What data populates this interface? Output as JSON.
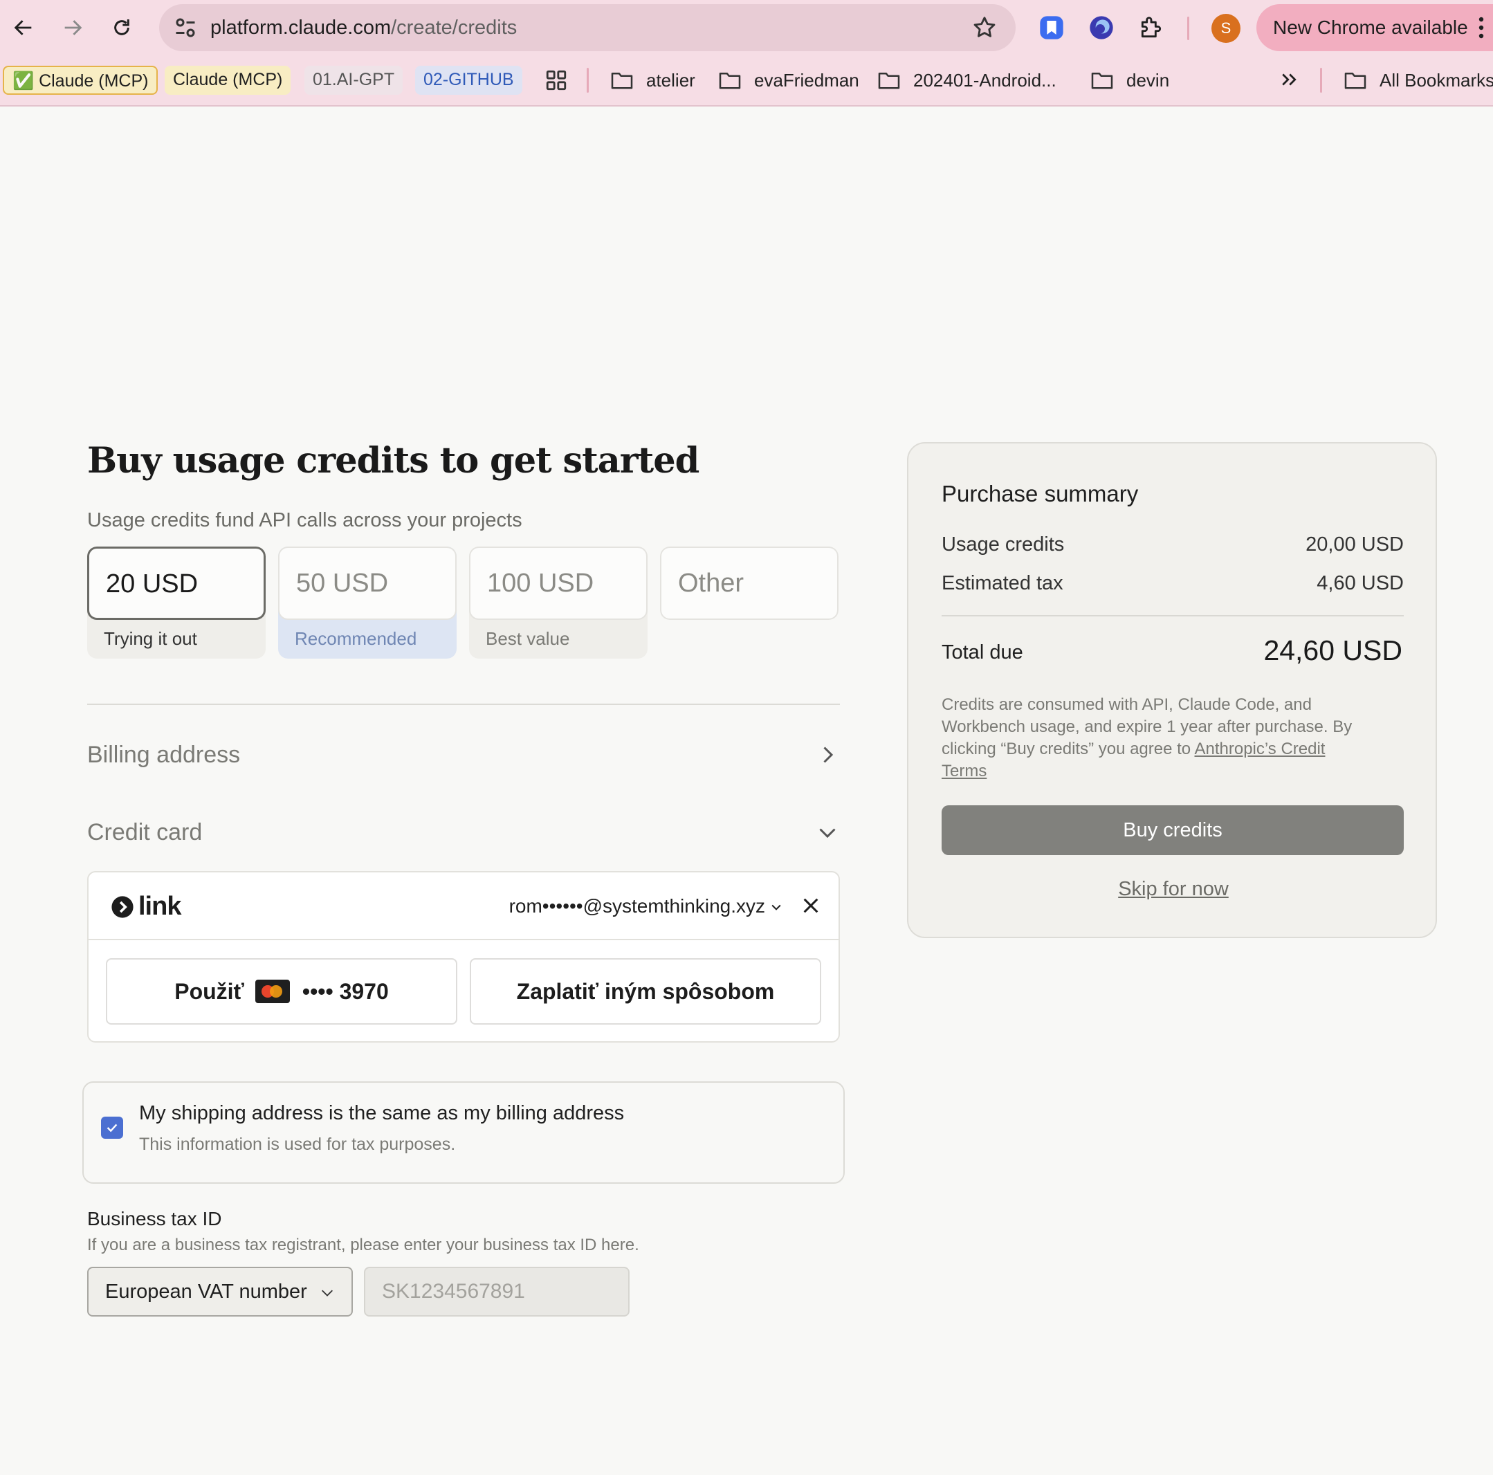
{
  "browser": {
    "url_host": "platform.claude.com",
    "url_path": "/create/credits",
    "avatar_letter": "S",
    "update_label": "New Chrome available"
  },
  "bookmarks": {
    "chips": [
      {
        "label": "✅ Claude (MCP)",
        "color": "#1f1f1f",
        "bg": "#f8edc3",
        "border": "#e6b34a"
      },
      {
        "label": "Claude (MCP)",
        "color": "#1f1f1f",
        "bg": "#f8edc3",
        "border": "transparent"
      },
      {
        "label": "01.AI-GPT",
        "color": "#555555",
        "bg": "#efe3e8",
        "border": "transparent"
      },
      {
        "label": "02-GITHUB",
        "color": "#2f5ab8",
        "bg": "#dfe3f3",
        "border": "transparent"
      }
    ],
    "folders": [
      "atelier",
      "evaFriedman",
      "202401-Android...",
      "devin"
    ],
    "all_bookmarks": "All Bookmarks"
  },
  "main": {
    "title": "Buy usage credits to get started",
    "subtitle": "Usage credits fund API calls across your projects",
    "amounts": [
      {
        "value": "20 USD",
        "tag": "Trying it out",
        "selected": true
      },
      {
        "value": "50 USD",
        "tag": "Recommended",
        "selected": false
      },
      {
        "value": "100 USD",
        "tag": "Best value",
        "selected": false
      },
      {
        "value": "Other",
        "tag": "",
        "selected": false
      }
    ],
    "billing_address_label": "Billing address",
    "credit_card_label": "Credit card",
    "link": {
      "logo_text": "link",
      "email": "rom••••••@systemthinking.xyz",
      "use_prefix": "Použiť",
      "card_last4": "•••• 3970",
      "other_method": "Zaplatiť iným spôsobom"
    },
    "shipping": {
      "label": "My shipping address is the same as my billing address",
      "help": "This information is used for tax purposes.",
      "checked": true
    },
    "business_tax": {
      "label": "Business tax ID",
      "help": "If you are a business tax registrant, please enter your business tax ID here.",
      "type_selected": "European VAT number",
      "placeholder": "SK1234567891"
    }
  },
  "summary": {
    "title": "Purchase summary",
    "usage_credits_label": "Usage credits",
    "usage_credits_value": "20,00 USD",
    "estimated_tax_label": "Estimated tax",
    "estimated_tax_value": "4,60 USD",
    "total_label": "Total due",
    "total_value": "24,60 USD",
    "note_text": "Credits are consumed with API, Claude Code, and Workbench usage, and expire 1 year after purchase. By clicking “Buy credits” you agree to ",
    "note_link": "Anthropic’s Credit Terms",
    "buy_button": "Buy credits",
    "skip_link": "Skip for now"
  }
}
